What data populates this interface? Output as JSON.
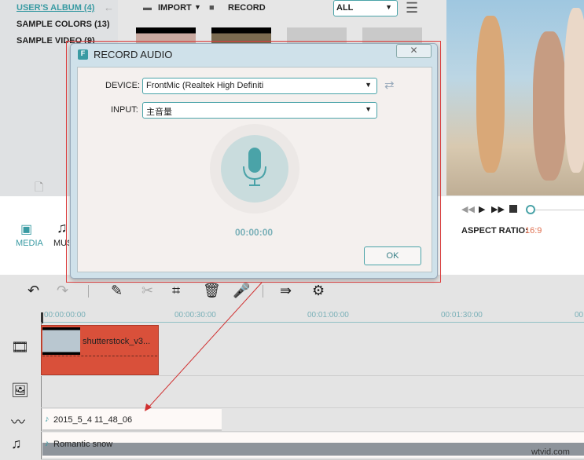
{
  "sidebar": {
    "items": [
      {
        "label": "USER'S ALBUM (4)"
      },
      {
        "label": "SAMPLE COLORS (13)"
      },
      {
        "label": "SAMPLE VIDEO (9)"
      }
    ]
  },
  "media_toolbar": {
    "import": "IMPORT",
    "record": "RECORD",
    "filter": "ALL"
  },
  "tabs": {
    "media": "MEDIA",
    "music": "MUSIC"
  },
  "player": {
    "aspect_label": "ASPECT RATIO:",
    "aspect_value": "16:9",
    "progress": 0
  },
  "dialog": {
    "title": "RECORD AUDIO",
    "device_label": "DEVICE:",
    "device_value": "FrontMic (Realtek High Definiti",
    "input_label": "INPUT:",
    "input_value": "主音量",
    "timer": "00:00:00",
    "ok": "OK"
  },
  "ruler": [
    "00:00:00:00",
    "00:00:30:00",
    "00:01:00:00",
    "00:01:30:00",
    "00"
  ],
  "clips": {
    "video": "shutterstock_v3...",
    "recording": "2015_5_4 11_48_06",
    "music": "Romantic snow"
  },
  "watermark": "wtvid.com",
  "colors": {
    "accent": "#4aa3a8",
    "clip": "#d9503a",
    "aspect": "#e07050"
  }
}
